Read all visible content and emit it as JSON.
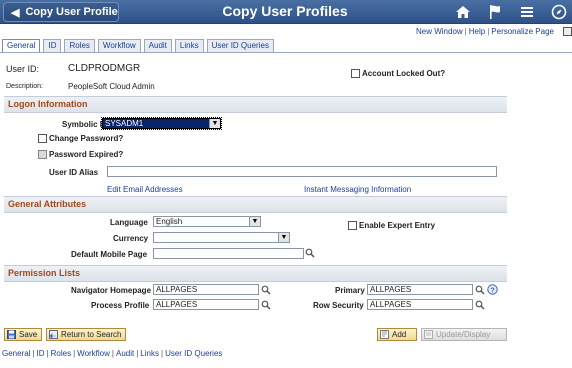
{
  "header": {
    "back_label": "Copy User Profile",
    "title": "Copy User Profiles",
    "icons": [
      "home-icon",
      "flag-icon",
      "menu-icon",
      "navbar-icon"
    ]
  },
  "top_links": [
    "New Window",
    "Help",
    "Personalize Page"
  ],
  "tabs": [
    "General",
    "ID",
    "Roles",
    "Workflow",
    "Audit",
    "Links",
    "User ID Queries"
  ],
  "user_id": {
    "label": "User ID:",
    "value": "CLDPRODMGR"
  },
  "description": {
    "label": "Description:",
    "value": "PeopleSoft Cloud Admin"
  },
  "account_locked": {
    "label": "Account Locked Out?",
    "checked": false
  },
  "logon": {
    "title": "Logon Information",
    "symbolic_id_label": "Symbolic ID",
    "symbolic_id_value": "SYSADM1",
    "change_password_label": "Change Password?",
    "password_expired_label": "Password Expired?",
    "user_id_alias_label": "User ID Alias",
    "user_id_alias_value": "",
    "edit_email_link": "Edit Email Addresses",
    "instant_messaging_link": "Instant Messaging Information"
  },
  "general": {
    "title": "General Attributes",
    "language_label": "Language",
    "language_value": "English",
    "currency_label": "Currency",
    "currency_value": "",
    "default_mobile_label": "Default Mobile Page",
    "default_mobile_value": "",
    "expert_entry_label": "Enable Expert Entry"
  },
  "permissions": {
    "title": "Permission Lists",
    "navigator_label": "Navigator Homepage",
    "navigator_value": "ALLPAGES",
    "process_label": "Process Profile",
    "process_value": "ALLPAGES",
    "primary_label": "Primary",
    "primary_value": "ALLPAGES",
    "row_security_label": "Row Security",
    "row_security_value": "ALLPAGES"
  },
  "buttons": {
    "save": "Save",
    "return": "Return to Search",
    "add": "Add",
    "update": "Update/Display"
  },
  "bottom_links": [
    "General",
    "ID",
    "Roles",
    "Workflow",
    "Audit",
    "Links",
    "User ID Queries"
  ],
  "colors": {
    "header": "#2e5288",
    "section_title": "#a0491c",
    "link": "#1a3f9a"
  }
}
